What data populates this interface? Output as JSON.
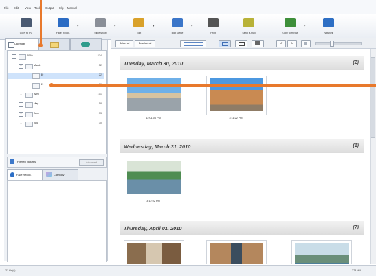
{
  "menu": [
    "File",
    "Edit",
    "View",
    "Tools",
    "Output",
    "Help",
    "Manual"
  ],
  "toolbar": [
    {
      "label": "Copy to PC",
      "icon": "copy-to-pc-icon"
    },
    {
      "label": "Face Recog.",
      "icon": "face-recognition-icon"
    },
    {
      "label": "Slide show",
      "icon": "slide-show-icon"
    },
    {
      "label": "Edit",
      "icon": "edit-icon"
    },
    {
      "label": "Edit scene",
      "icon": "edit-scene-icon"
    },
    {
      "label": "Print",
      "icon": "print-icon"
    },
    {
      "label": "Send e-mail",
      "icon": "send-email-icon"
    },
    {
      "label": "Copy to media",
      "icon": "copy-to-media-icon"
    },
    {
      "label": "Network",
      "icon": "network-icon"
    }
  ],
  "left": {
    "tab_active_label": "Calendar",
    "tree": [
      {
        "label": "2010",
        "count": "274",
        "level": 0,
        "expander": "−"
      },
      {
        "label": "March",
        "count": "52",
        "level": 1,
        "expander": "−"
      },
      {
        "label": "30",
        "count": "22",
        "level": 2,
        "expander": "",
        "selected": true
      },
      {
        "label": "31",
        "count": "30",
        "level": 2,
        "expander": ""
      },
      {
        "label": "April",
        "count": "101",
        "level": 1,
        "expander": "+"
      },
      {
        "label": "May",
        "count": "58",
        "level": 1,
        "expander": "+"
      },
      {
        "label": "June",
        "count": "33",
        "level": 1,
        "expander": "+"
      },
      {
        "label": "July",
        "count": "30",
        "level": 1,
        "expander": "+"
      }
    ],
    "filter_label": "Filtered pictures",
    "filter_button": "Advanced",
    "subtabs": [
      "Face Recog.",
      "Category"
    ]
  },
  "viewbar": {
    "select_all": "Select all",
    "deselect_all": "Deselect all"
  },
  "days": [
    {
      "title": "Tuesday, March 30, 2010",
      "count": "(2)",
      "photos": [
        {
          "time": "12:01:06 PM",
          "scene": "plaza"
        },
        {
          "time": "3:11:22 PM",
          "scene": "building"
        }
      ]
    },
    {
      "title": "Wednesday, March 31, 2010",
      "count": "(1)",
      "photos": [
        {
          "time": "3:12:02 PM",
          "scene": "bridge"
        }
      ]
    },
    {
      "title": "Thursday, April 01, 2010",
      "count": "(7)",
      "photos": [
        {
          "time": "",
          "scene": "street"
        },
        {
          "time": "",
          "scene": "arch"
        },
        {
          "time": "",
          "scene": "river"
        }
      ]
    }
  ],
  "status": {
    "left": "22 file(s)",
    "right": "273 MB"
  }
}
